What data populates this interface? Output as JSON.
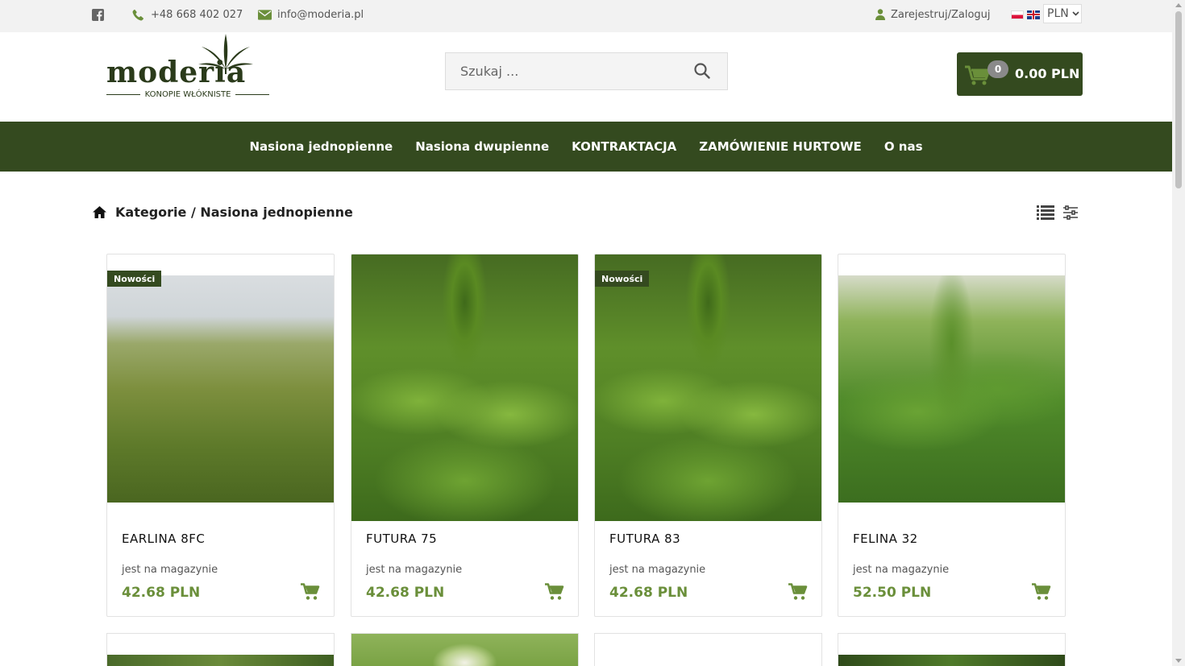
{
  "topbar": {
    "facebook_icon": "facebook-icon",
    "phone": "+48 668 402 027",
    "email": "info@moderia.pl",
    "account": "Zarejestruj/Zaloguj",
    "currency": "PLN"
  },
  "logo": {
    "wordmark": "moderia",
    "tagline": "KONOPIE WŁÓKNISTE"
  },
  "search": {
    "placeholder": "Szukaj ..."
  },
  "cart": {
    "count": "0",
    "total": "0.00 PLN"
  },
  "nav": {
    "items": [
      "Nasiona jednopienne",
      "Nasiona dwupienne",
      "KONTRAKTACJA",
      "ZAMÓWIENIE HURTOWE",
      "O nas"
    ]
  },
  "breadcrumb": {
    "text": "Kategorie / Nasiona jednopienne"
  },
  "products": [
    {
      "name": "EARLINA 8FC",
      "badge": "Nowości",
      "stock": "jest na magazynie",
      "price": "42.68 PLN"
    },
    {
      "name": "FUTURA 75",
      "badge": "",
      "stock": "jest na magazynie",
      "price": "42.68 PLN"
    },
    {
      "name": "FUTURA 83",
      "badge": "Nowości",
      "stock": "jest na magazynie",
      "price": "42.68 PLN"
    },
    {
      "name": "FELINA 32",
      "badge": "",
      "stock": "jest na magazynie",
      "price": "52.50 PLN"
    }
  ],
  "colors": {
    "brand_green": "#344a1f",
    "price_green": "#6a8f3a",
    "topbar_bg": "#f2f2f2"
  }
}
